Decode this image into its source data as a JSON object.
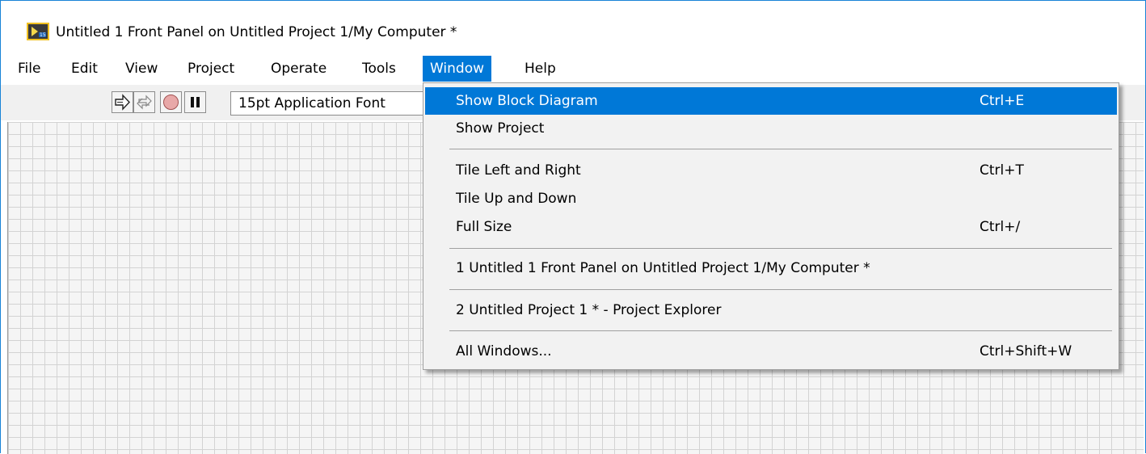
{
  "window": {
    "title": "Untitled 1 Front Panel on Untitled Project 1/My Computer *"
  },
  "menubar": {
    "items": [
      "File",
      "Edit",
      "View",
      "Project",
      "Operate",
      "Tools",
      "Window",
      "Help"
    ],
    "active": "Window"
  },
  "toolbar": {
    "font": "15pt Application Font"
  },
  "window_menu": {
    "items": [
      {
        "label": "Show Block Diagram",
        "shortcut": "Ctrl+E",
        "highlighted": true
      },
      {
        "label": "Show Project",
        "shortcut": ""
      },
      {
        "label": "Tile Left and Right",
        "shortcut": "Ctrl+T"
      },
      {
        "label": "Tile Up and Down",
        "shortcut": ""
      },
      {
        "label": "Full Size",
        "shortcut": "Ctrl+/"
      },
      {
        "label": "1 Untitled 1 Front Panel on Untitled Project 1/My Computer *",
        "shortcut": ""
      },
      {
        "label": "2 Untitled Project 1 * - Project Explorer",
        "shortcut": ""
      },
      {
        "label": "All Windows...",
        "shortcut": "Ctrl+Shift+W"
      }
    ]
  },
  "icons": {
    "app": "labview-vi-icon",
    "run": "run-arrow-icon",
    "run_continuously": "run-continuously-icon",
    "abort": "abort-stop-icon",
    "pause": "pause-icon"
  },
  "colors": {
    "accent": "#0078d7",
    "window_border": "#1883d7",
    "grid": "#d3d3d3",
    "panel_bg": "#f5f5f5"
  }
}
